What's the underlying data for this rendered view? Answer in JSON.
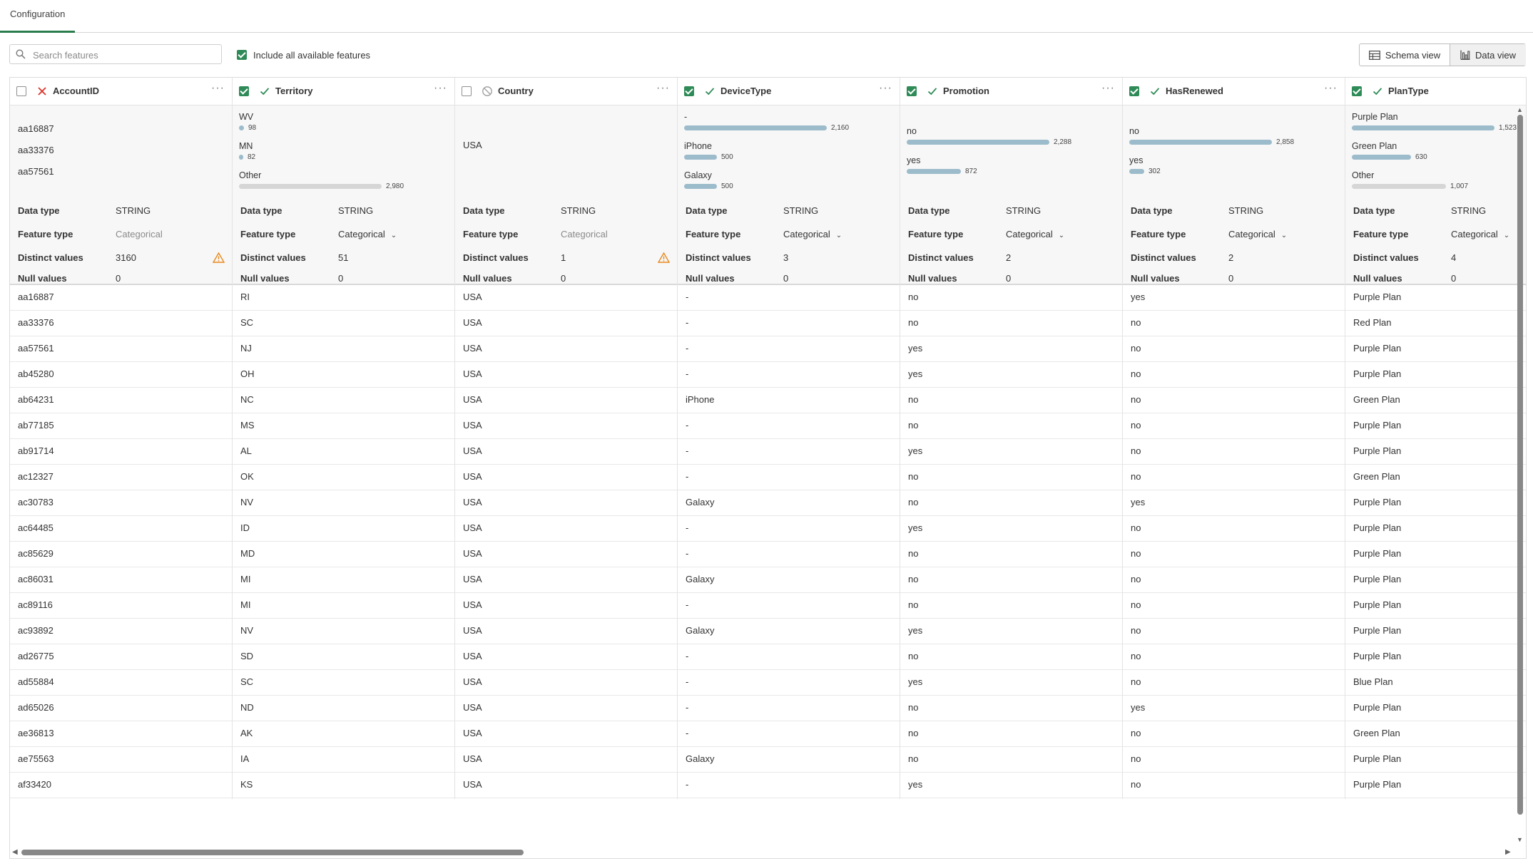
{
  "tabs": [
    {
      "label": "Configuration"
    }
  ],
  "search": {
    "placeholder": "Search features"
  },
  "include_all": {
    "label": "Include all available features",
    "checked": true
  },
  "views": {
    "schema": "Schema view",
    "data": "Data view"
  },
  "columns": [
    {
      "name": "AccountID",
      "checked": false,
      "status": "excluded",
      "summary": {
        "kind": "list",
        "values": [
          "aa16887",
          "aa33376",
          "aa57561"
        ]
      },
      "props": {
        "data_type_label": "Data type",
        "data_type": "STRING",
        "feature_type_label": "Feature type",
        "feature_type": "Categorical",
        "feature_type_editable": false,
        "distinct_label": "Distinct values",
        "distinct": "3160",
        "distinct_warning": true,
        "null_label": "Null values",
        "null": "0"
      },
      "cells": [
        "aa16887",
        "aa33376",
        "aa57561",
        "ab45280",
        "ab64231",
        "ab77185",
        "ab91714",
        "ac12327",
        "ac30783",
        "ac64485",
        "ac85629",
        "ac86031",
        "ac89116",
        "ac93892",
        "ad26775",
        "ad55884",
        "ad65026",
        "ae36813",
        "ae75563",
        "af33420"
      ]
    },
    {
      "name": "Territory",
      "checked": true,
      "status": "included",
      "summary": {
        "kind": "dist",
        "rows": [
          {
            "label": "WV",
            "count": "98",
            "fraction": 0.033,
            "other": false
          },
          {
            "label": "MN",
            "count": "82",
            "fraction": 0.028,
            "other": false
          },
          {
            "label": "Other",
            "count": "2,980",
            "fraction": 1.0,
            "other": true
          }
        ]
      },
      "props": {
        "data_type_label": "Data type",
        "data_type": "STRING",
        "feature_type_label": "Feature type",
        "feature_type": "Categorical",
        "feature_type_editable": true,
        "distinct_label": "Distinct values",
        "distinct": "51",
        "distinct_warning": false,
        "null_label": "Null values",
        "null": "0"
      },
      "cells": [
        "RI",
        "SC",
        "NJ",
        "OH",
        "NC",
        "MS",
        "AL",
        "OK",
        "NV",
        "ID",
        "MD",
        "MI",
        "MI",
        "NV",
        "SD",
        "SC",
        "ND",
        "AK",
        "IA",
        "KS"
      ]
    },
    {
      "name": "Country",
      "checked": false,
      "status": "disabled",
      "summary": {
        "kind": "single",
        "value": "USA"
      },
      "props": {
        "data_type_label": "Data type",
        "data_type": "STRING",
        "feature_type_label": "Feature type",
        "feature_type": "Categorical",
        "feature_type_editable": false,
        "distinct_label": "Distinct values",
        "distinct": "1",
        "distinct_warning": true,
        "null_label": "Null values",
        "null": "0"
      },
      "cells": [
        "USA",
        "USA",
        "USA",
        "USA",
        "USA",
        "USA",
        "USA",
        "USA",
        "USA",
        "USA",
        "USA",
        "USA",
        "USA",
        "USA",
        "USA",
        "USA",
        "USA",
        "USA",
        "USA",
        "USA"
      ]
    },
    {
      "name": "DeviceType",
      "checked": true,
      "status": "included",
      "summary": {
        "kind": "dist",
        "rows": [
          {
            "label": "-",
            "count": "2,160",
            "fraction": 1.0,
            "other": false
          },
          {
            "label": "iPhone",
            "count": "500",
            "fraction": 0.231,
            "other": false
          },
          {
            "label": "Galaxy",
            "count": "500",
            "fraction": 0.231,
            "other": false
          }
        ]
      },
      "props": {
        "data_type_label": "Data type",
        "data_type": "STRING",
        "feature_type_label": "Feature type",
        "feature_type": "Categorical",
        "feature_type_editable": true,
        "distinct_label": "Distinct values",
        "distinct": "3",
        "distinct_warning": false,
        "null_label": "Null values",
        "null": "0"
      },
      "cells": [
        "-",
        "-",
        "-",
        "-",
        "iPhone",
        "-",
        "-",
        "-",
        "Galaxy",
        "-",
        "-",
        "Galaxy",
        "-",
        "Galaxy",
        "-",
        "-",
        "-",
        "-",
        "Galaxy",
        "-"
      ]
    },
    {
      "name": "Promotion",
      "checked": true,
      "status": "included",
      "summary": {
        "kind": "dist",
        "rows": [
          {
            "label": "no",
            "count": "2,288",
            "fraction": 1.0,
            "other": false
          },
          {
            "label": "yes",
            "count": "872",
            "fraction": 0.381,
            "other": false
          }
        ]
      },
      "props": {
        "data_type_label": "Data type",
        "data_type": "STRING",
        "feature_type_label": "Feature type",
        "feature_type": "Categorical",
        "feature_type_editable": true,
        "distinct_label": "Distinct values",
        "distinct": "2",
        "distinct_warning": false,
        "null_label": "Null values",
        "null": "0"
      },
      "cells": [
        "no",
        "no",
        "yes",
        "yes",
        "no",
        "no",
        "yes",
        "no",
        "no",
        "yes",
        "no",
        "no",
        "no",
        "yes",
        "no",
        "yes",
        "no",
        "no",
        "no",
        "yes"
      ]
    },
    {
      "name": "HasRenewed",
      "checked": true,
      "status": "included",
      "summary": {
        "kind": "dist",
        "rows": [
          {
            "label": "no",
            "count": "2,858",
            "fraction": 1.0,
            "other": false
          },
          {
            "label": "yes",
            "count": "302",
            "fraction": 0.106,
            "other": false
          }
        ]
      },
      "props": {
        "data_type_label": "Data type",
        "data_type": "STRING",
        "feature_type_label": "Feature type",
        "feature_type": "Categorical",
        "feature_type_editable": true,
        "distinct_label": "Distinct values",
        "distinct": "2",
        "distinct_warning": false,
        "null_label": "Null values",
        "null": "0"
      },
      "cells": [
        "yes",
        "no",
        "no",
        "no",
        "no",
        "no",
        "no",
        "no",
        "yes",
        "no",
        "no",
        "no",
        "no",
        "no",
        "no",
        "no",
        "yes",
        "no",
        "no",
        "no"
      ]
    },
    {
      "name": "PlanType",
      "checked": true,
      "status": "included",
      "summary": {
        "kind": "dist",
        "rows": [
          {
            "label": "Purple Plan",
            "count": "1,523",
            "fraction": 1.0,
            "other": false
          },
          {
            "label": "Green Plan",
            "count": "630",
            "fraction": 0.414,
            "other": false
          },
          {
            "label": "Other",
            "count": "1,007",
            "fraction": 0.661,
            "other": true
          }
        ]
      },
      "props": {
        "data_type_label": "Data type",
        "data_type": "STRING",
        "feature_type_label": "Feature type",
        "feature_type": "Categorical",
        "feature_type_editable": true,
        "distinct_label": "Distinct values",
        "distinct": "4",
        "distinct_warning": false,
        "null_label": "Null values",
        "null": "0"
      },
      "cells": [
        "Purple Plan",
        "Red Plan",
        "Purple Plan",
        "Purple Plan",
        "Green Plan",
        "Purple Plan",
        "Purple Plan",
        "Green Plan",
        "Purple Plan",
        "Purple Plan",
        "Purple Plan",
        "Purple Plan",
        "Purple Plan",
        "Purple Plan",
        "Purple Plan",
        "Blue Plan",
        "Purple Plan",
        "Green Plan",
        "Purple Plan",
        "Purple Plan"
      ]
    }
  ],
  "colors": {
    "accent": "#2e8b57",
    "bar": "#9cbccb",
    "bar_other": "#d6d6d6",
    "error": "#d9342b",
    "warning": "#e8891c"
  },
  "icons": {
    "search": "search-icon",
    "schema": "table-icon",
    "data": "bar-chart-icon",
    "more": "more-icon",
    "warning": "warning-icon"
  }
}
